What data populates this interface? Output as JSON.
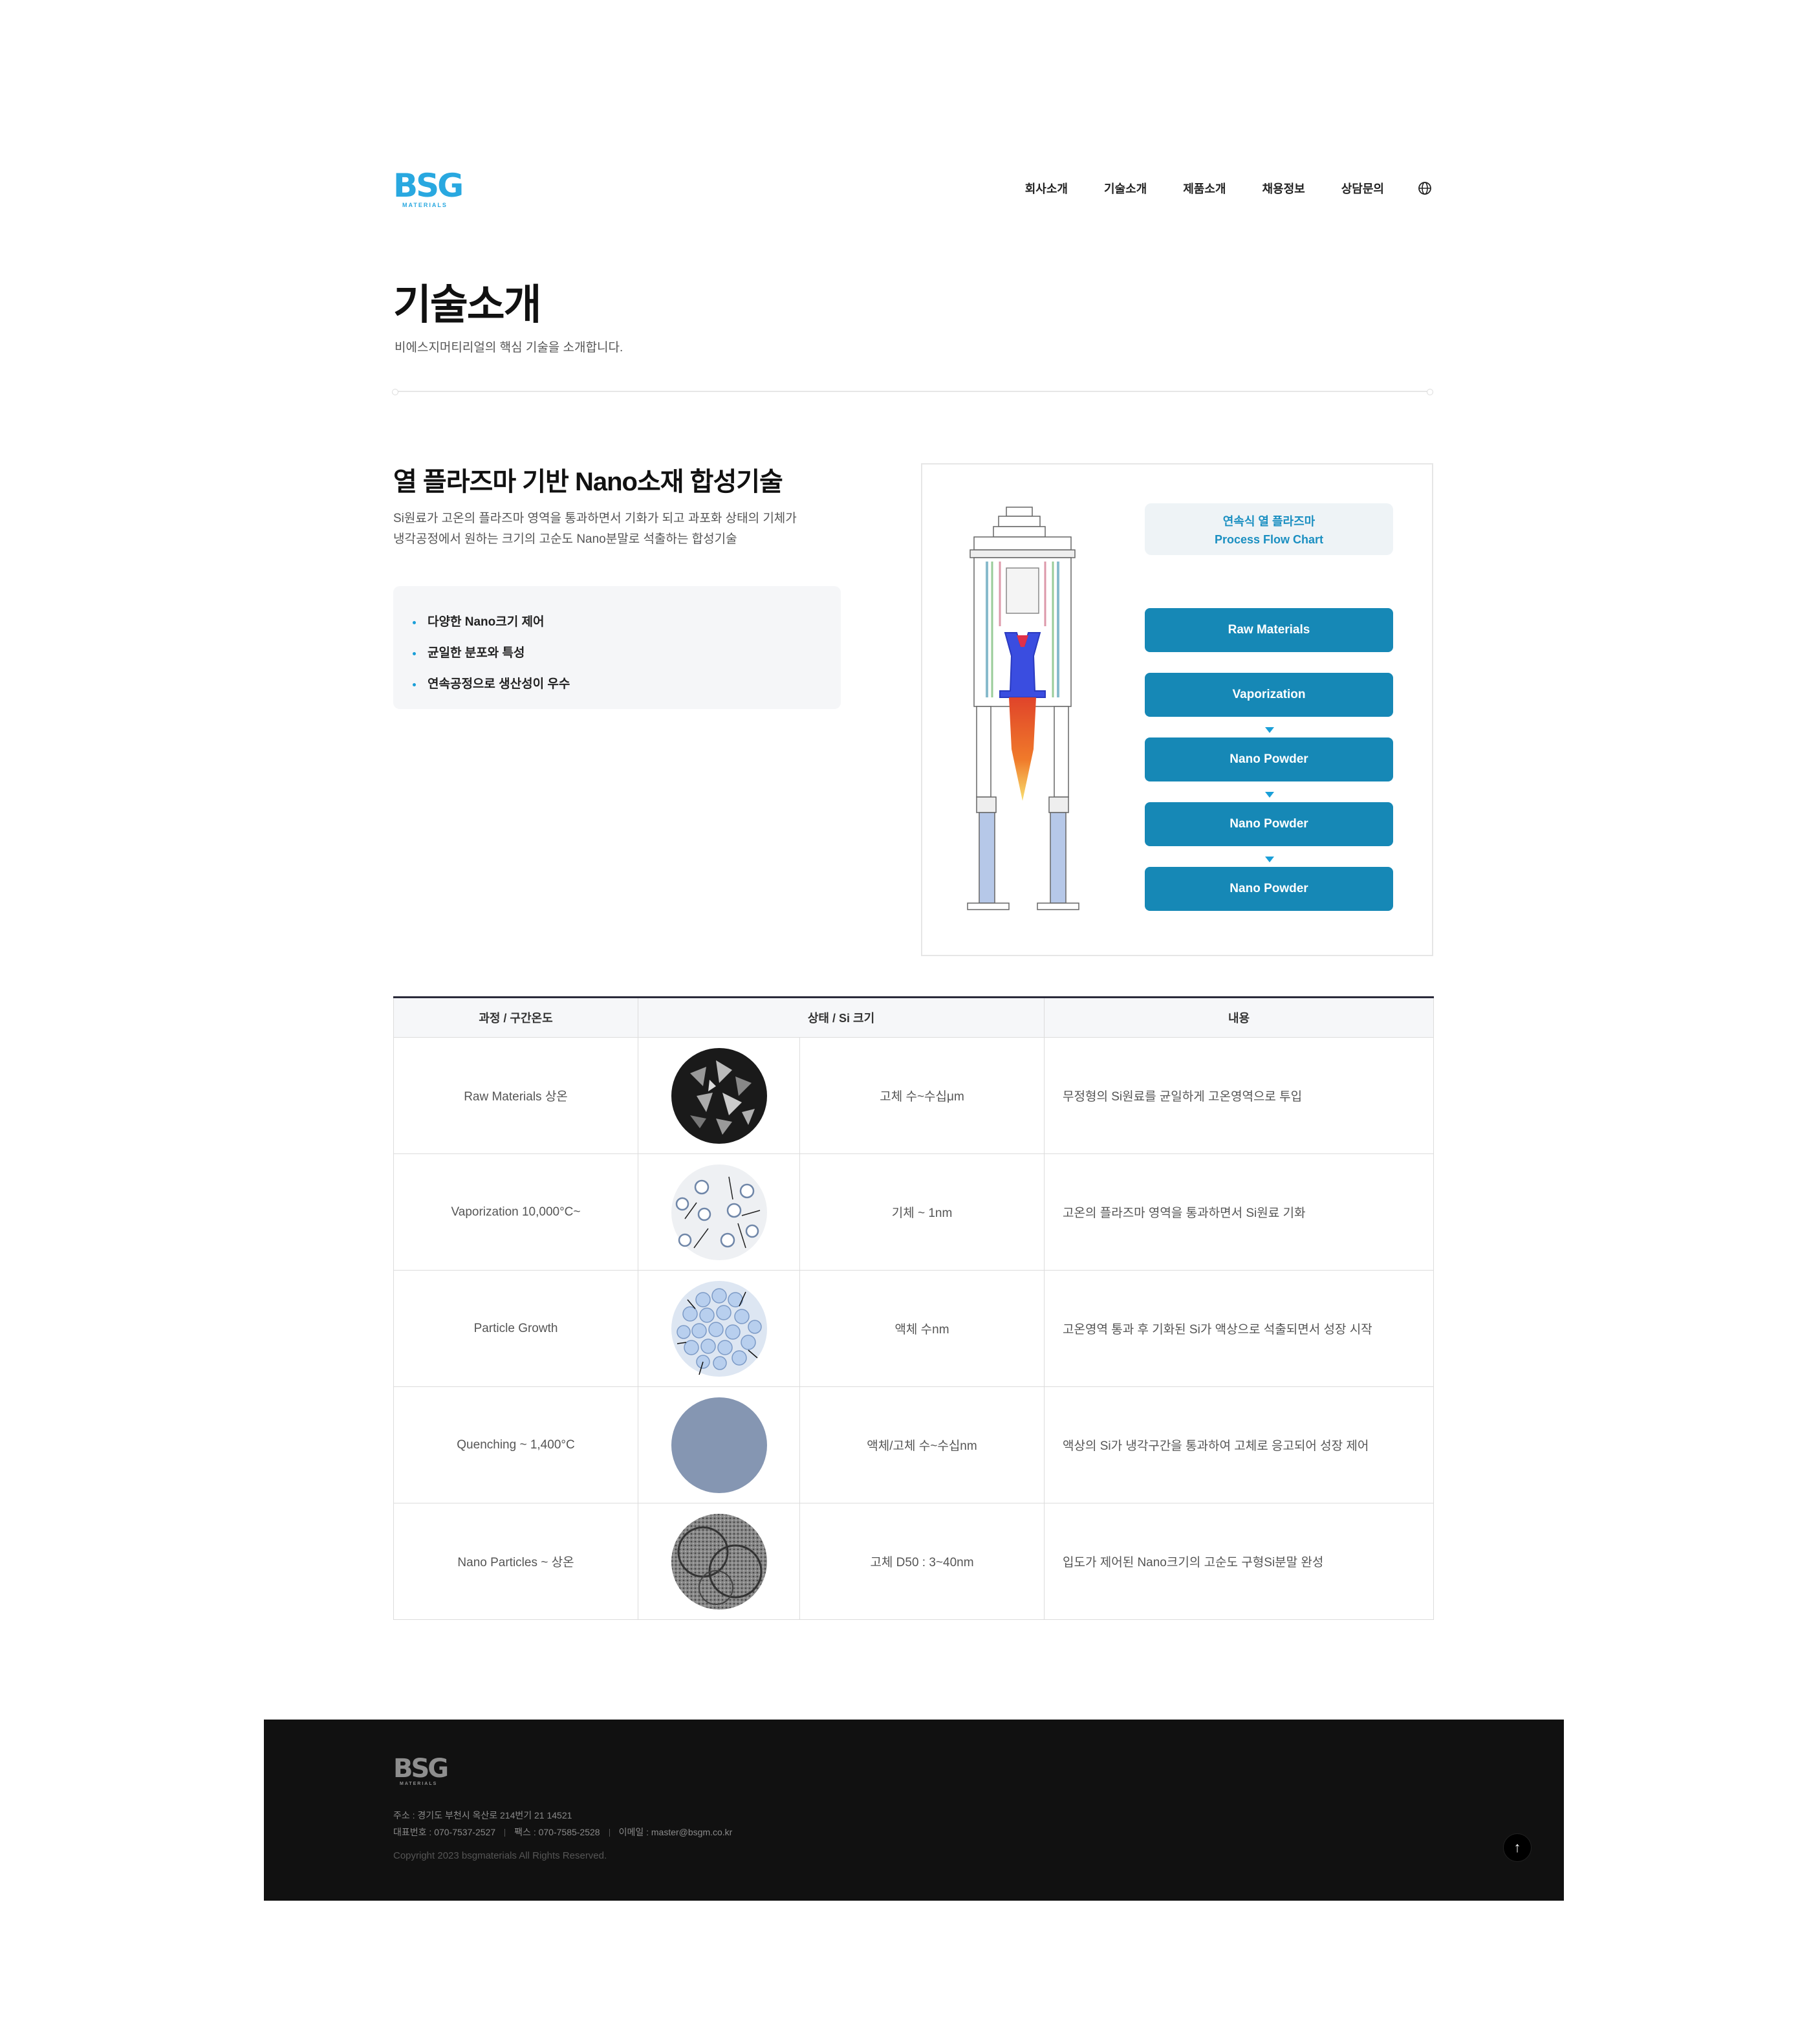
{
  "header": {
    "logo": "BSG",
    "logo_sub": "MATERIALS",
    "nav": [
      "회사소개",
      "기술소개",
      "제품소개",
      "채용정보",
      "상담문의"
    ],
    "language_icon": "globe-icon"
  },
  "page": {
    "title": "기술소개",
    "subtitle": "비에스지머티리얼의 핵심 기술을 소개합니다."
  },
  "section": {
    "title": "열 플라즈마 기반 Nano소재 합성기술",
    "desc_line1": "Si원료가 고온의 플라즈마 영역을 통과하면서 기화가 되고 과포화 상태의 기체가",
    "desc_line2": "냉각공정에서 원하는 크기의 고순도 Nano분말로 석출하는 합성기술",
    "features": [
      "다양한 Nano크기 제어",
      "균일한 분포와 특성",
      "연속공정으로 생산성이 우수"
    ]
  },
  "flow": {
    "head_line1": "연속식 열 플라즈마",
    "head_line2": "Process Flow Chart",
    "steps": [
      "Raw Materials",
      "Vaporization",
      "Nano Powder",
      "Nano Powder",
      "Nano Powder"
    ]
  },
  "table": {
    "headers": [
      "과정 / 구간온도",
      "상태 / Si 크기",
      "내용"
    ],
    "rows": [
      {
        "process": "Raw Materials 상온",
        "state": "고체 수~수십μm",
        "content": "무정형의 Si원료를 균일하게 고온영역으로 투입"
      },
      {
        "process": "Vaporization 10,000°C~",
        "state": "기체 ~ 1nm",
        "content": "고온의 플라즈마 영역을 통과하면서 Si원료 기화"
      },
      {
        "process": "Particle Growth",
        "state": "액체 수nm",
        "content": "고온영역 통과 후 기화된 Si가 액상으로 석출되면서 성장 시작"
      },
      {
        "process": "Quenching ~ 1,400°C",
        "state": "액체/고체 수~수십nm",
        "content": "액상의 Si가 냉각구간을 통과하여 고체로 응고되어 성장 제어"
      },
      {
        "process": "Nano Particles ~ 상온",
        "state": "고체 D50 : 3~40nm",
        "content": "입도가 제어된 Nano크기의 고순도 구형Si분말 완성"
      }
    ]
  },
  "footer": {
    "logo": "BSG",
    "logo_sub": "MATERIALS",
    "address": "주소 : 경기도 부천시 옥산로 214번기 21 14521",
    "tel": "대표번호 : 070-7537-2527",
    "fax": "팩스 : 070-7585-2528",
    "email": "이메일 : master@bsgm.co.kr",
    "copyright": "Copyright 2023 bsgmaterials All Rights Reserved.",
    "top_button": "↑"
  },
  "colors": {
    "brand": "#29a8e0",
    "flow_button": "#1688b6",
    "footer_bg": "#111111"
  }
}
